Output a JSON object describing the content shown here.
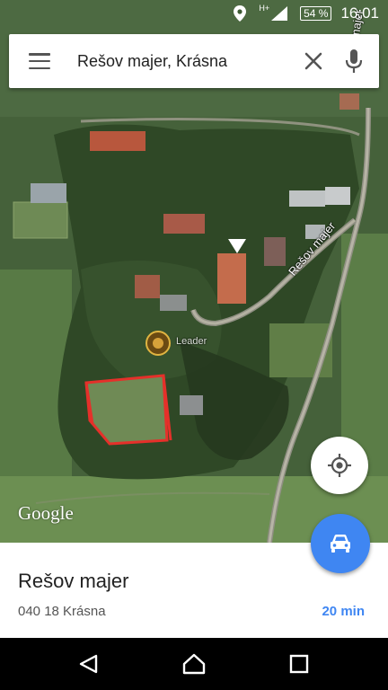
{
  "status_bar": {
    "network": "H+",
    "battery": "54 %",
    "time": "16:01"
  },
  "search": {
    "query": "Rešov majer, Krásna"
  },
  "map": {
    "street_labels": [
      "Rešov majer",
      "Rešov majer"
    ],
    "poi_label": "Leader",
    "attribution": "Google"
  },
  "place": {
    "name": "Rešov majer",
    "address": "040 18 Krásna",
    "travel_time": "20 min"
  },
  "icons": {
    "menu": "hamburger-icon",
    "clear": "close-icon",
    "voice": "mic-icon",
    "location": "my-location-icon",
    "directions": "car-icon",
    "nav_back": "back-triangle-icon",
    "nav_home": "home-circle-icon",
    "nav_recents": "recents-square-icon"
  },
  "colors": {
    "accent": "#3f86f2",
    "boundary": "#e5302a"
  }
}
